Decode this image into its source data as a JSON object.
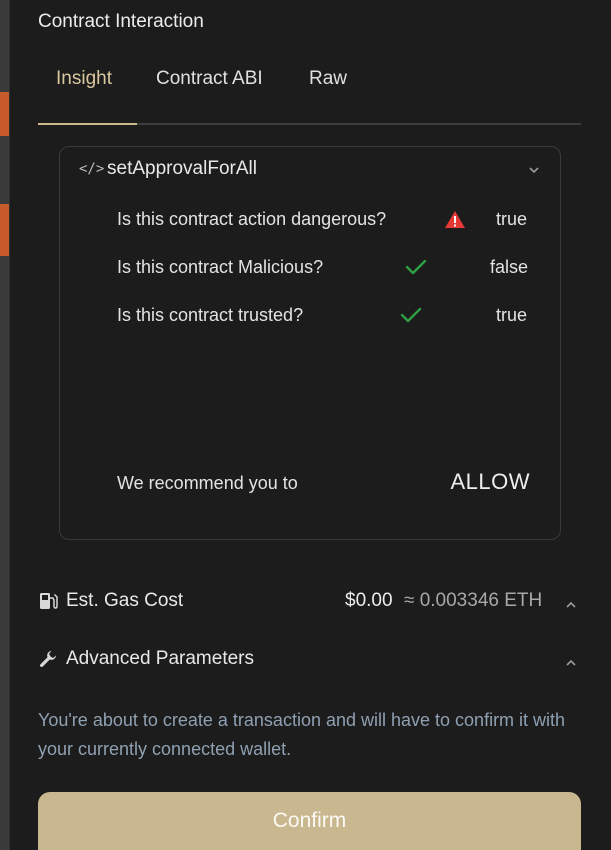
{
  "modal": {
    "title": "Contract Interaction",
    "tabs": [
      {
        "label": "Insight",
        "active": true
      },
      {
        "label": "Contract ABI",
        "active": false
      },
      {
        "label": "Raw",
        "active": false
      }
    ]
  },
  "insight": {
    "function_name": "setApprovalForAll",
    "code_icon": "code-icon",
    "checks": [
      {
        "question": "Is this contract action dangerous?",
        "icon": "warning-icon",
        "answer": "true"
      },
      {
        "question": "Is this contract Malicious?",
        "icon": "check-icon",
        "answer": "false"
      },
      {
        "question": "Is this contract trusted?",
        "icon": "check-icon",
        "answer": "true"
      }
    ],
    "recommend_label": "We recommend you to",
    "recommendation": "ALLOW"
  },
  "gas": {
    "label": "Est. Gas Cost",
    "usd": "$0.00",
    "eth": "≈ 0.003346 ETH",
    "icon": "gas-pump-icon"
  },
  "advanced": {
    "label": "Advanced Parameters",
    "icon": "wrench-icon"
  },
  "note": "You're about to create a transaction and will have to confirm it with your currently connected wallet.",
  "confirm_label": "Confirm",
  "colors": {
    "accent": "#c9b78f",
    "warning": "#e53935",
    "success": "#2ea043",
    "note_text": "#8fa0b2"
  }
}
